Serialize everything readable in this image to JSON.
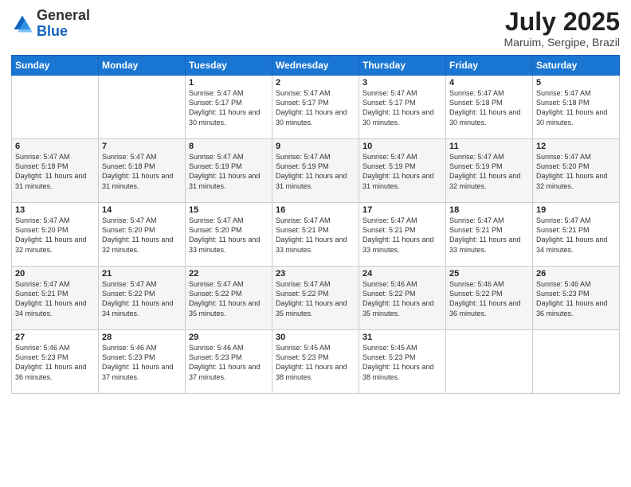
{
  "logo": {
    "text_general": "General",
    "text_blue": "Blue"
  },
  "title": {
    "month_year": "July 2025",
    "location": "Maruim, Sergipe, Brazil"
  },
  "weekdays": [
    "Sunday",
    "Monday",
    "Tuesday",
    "Wednesday",
    "Thursday",
    "Friday",
    "Saturday"
  ],
  "weeks": [
    [
      {
        "day": "",
        "sunrise": "",
        "sunset": "",
        "daylight": ""
      },
      {
        "day": "",
        "sunrise": "",
        "sunset": "",
        "daylight": ""
      },
      {
        "day": "1",
        "sunrise": "Sunrise: 5:47 AM",
        "sunset": "Sunset: 5:17 PM",
        "daylight": "Daylight: 11 hours and 30 minutes."
      },
      {
        "day": "2",
        "sunrise": "Sunrise: 5:47 AM",
        "sunset": "Sunset: 5:17 PM",
        "daylight": "Daylight: 11 hours and 30 minutes."
      },
      {
        "day": "3",
        "sunrise": "Sunrise: 5:47 AM",
        "sunset": "Sunset: 5:17 PM",
        "daylight": "Daylight: 11 hours and 30 minutes."
      },
      {
        "day": "4",
        "sunrise": "Sunrise: 5:47 AM",
        "sunset": "Sunset: 5:18 PM",
        "daylight": "Daylight: 11 hours and 30 minutes."
      },
      {
        "day": "5",
        "sunrise": "Sunrise: 5:47 AM",
        "sunset": "Sunset: 5:18 PM",
        "daylight": "Daylight: 11 hours and 30 minutes."
      }
    ],
    [
      {
        "day": "6",
        "sunrise": "Sunrise: 5:47 AM",
        "sunset": "Sunset: 5:18 PM",
        "daylight": "Daylight: 11 hours and 31 minutes."
      },
      {
        "day": "7",
        "sunrise": "Sunrise: 5:47 AM",
        "sunset": "Sunset: 5:18 PM",
        "daylight": "Daylight: 11 hours and 31 minutes."
      },
      {
        "day": "8",
        "sunrise": "Sunrise: 5:47 AM",
        "sunset": "Sunset: 5:19 PM",
        "daylight": "Daylight: 11 hours and 31 minutes."
      },
      {
        "day": "9",
        "sunrise": "Sunrise: 5:47 AM",
        "sunset": "Sunset: 5:19 PM",
        "daylight": "Daylight: 11 hours and 31 minutes."
      },
      {
        "day": "10",
        "sunrise": "Sunrise: 5:47 AM",
        "sunset": "Sunset: 5:19 PM",
        "daylight": "Daylight: 11 hours and 31 minutes."
      },
      {
        "day": "11",
        "sunrise": "Sunrise: 5:47 AM",
        "sunset": "Sunset: 5:19 PM",
        "daylight": "Daylight: 11 hours and 32 minutes."
      },
      {
        "day": "12",
        "sunrise": "Sunrise: 5:47 AM",
        "sunset": "Sunset: 5:20 PM",
        "daylight": "Daylight: 11 hours and 32 minutes."
      }
    ],
    [
      {
        "day": "13",
        "sunrise": "Sunrise: 5:47 AM",
        "sunset": "Sunset: 5:20 PM",
        "daylight": "Daylight: 11 hours and 32 minutes."
      },
      {
        "day": "14",
        "sunrise": "Sunrise: 5:47 AM",
        "sunset": "Sunset: 5:20 PM",
        "daylight": "Daylight: 11 hours and 32 minutes."
      },
      {
        "day": "15",
        "sunrise": "Sunrise: 5:47 AM",
        "sunset": "Sunset: 5:20 PM",
        "daylight": "Daylight: 11 hours and 33 minutes."
      },
      {
        "day": "16",
        "sunrise": "Sunrise: 5:47 AM",
        "sunset": "Sunset: 5:21 PM",
        "daylight": "Daylight: 11 hours and 33 minutes."
      },
      {
        "day": "17",
        "sunrise": "Sunrise: 5:47 AM",
        "sunset": "Sunset: 5:21 PM",
        "daylight": "Daylight: 11 hours and 33 minutes."
      },
      {
        "day": "18",
        "sunrise": "Sunrise: 5:47 AM",
        "sunset": "Sunset: 5:21 PM",
        "daylight": "Daylight: 11 hours and 33 minutes."
      },
      {
        "day": "19",
        "sunrise": "Sunrise: 5:47 AM",
        "sunset": "Sunset: 5:21 PM",
        "daylight": "Daylight: 11 hours and 34 minutes."
      }
    ],
    [
      {
        "day": "20",
        "sunrise": "Sunrise: 5:47 AM",
        "sunset": "Sunset: 5:21 PM",
        "daylight": "Daylight: 11 hours and 34 minutes."
      },
      {
        "day": "21",
        "sunrise": "Sunrise: 5:47 AM",
        "sunset": "Sunset: 5:22 PM",
        "daylight": "Daylight: 11 hours and 34 minutes."
      },
      {
        "day": "22",
        "sunrise": "Sunrise: 5:47 AM",
        "sunset": "Sunset: 5:22 PM",
        "daylight": "Daylight: 11 hours and 35 minutes."
      },
      {
        "day": "23",
        "sunrise": "Sunrise: 5:47 AM",
        "sunset": "Sunset: 5:22 PM",
        "daylight": "Daylight: 11 hours and 35 minutes."
      },
      {
        "day": "24",
        "sunrise": "Sunrise: 5:46 AM",
        "sunset": "Sunset: 5:22 PM",
        "daylight": "Daylight: 11 hours and 35 minutes."
      },
      {
        "day": "25",
        "sunrise": "Sunrise: 5:46 AM",
        "sunset": "Sunset: 5:22 PM",
        "daylight": "Daylight: 11 hours and 36 minutes."
      },
      {
        "day": "26",
        "sunrise": "Sunrise: 5:46 AM",
        "sunset": "Sunset: 5:23 PM",
        "daylight": "Daylight: 11 hours and 36 minutes."
      }
    ],
    [
      {
        "day": "27",
        "sunrise": "Sunrise: 5:46 AM",
        "sunset": "Sunset: 5:23 PM",
        "daylight": "Daylight: 11 hours and 36 minutes."
      },
      {
        "day": "28",
        "sunrise": "Sunrise: 5:46 AM",
        "sunset": "Sunset: 5:23 PM",
        "daylight": "Daylight: 11 hours and 37 minutes."
      },
      {
        "day": "29",
        "sunrise": "Sunrise: 5:46 AM",
        "sunset": "Sunset: 5:23 PM",
        "daylight": "Daylight: 11 hours and 37 minutes."
      },
      {
        "day": "30",
        "sunrise": "Sunrise: 5:45 AM",
        "sunset": "Sunset: 5:23 PM",
        "daylight": "Daylight: 11 hours and 38 minutes."
      },
      {
        "day": "31",
        "sunrise": "Sunrise: 5:45 AM",
        "sunset": "Sunset: 5:23 PM",
        "daylight": "Daylight: 11 hours and 38 minutes."
      },
      {
        "day": "",
        "sunrise": "",
        "sunset": "",
        "daylight": ""
      },
      {
        "day": "",
        "sunrise": "",
        "sunset": "",
        "daylight": ""
      }
    ]
  ]
}
